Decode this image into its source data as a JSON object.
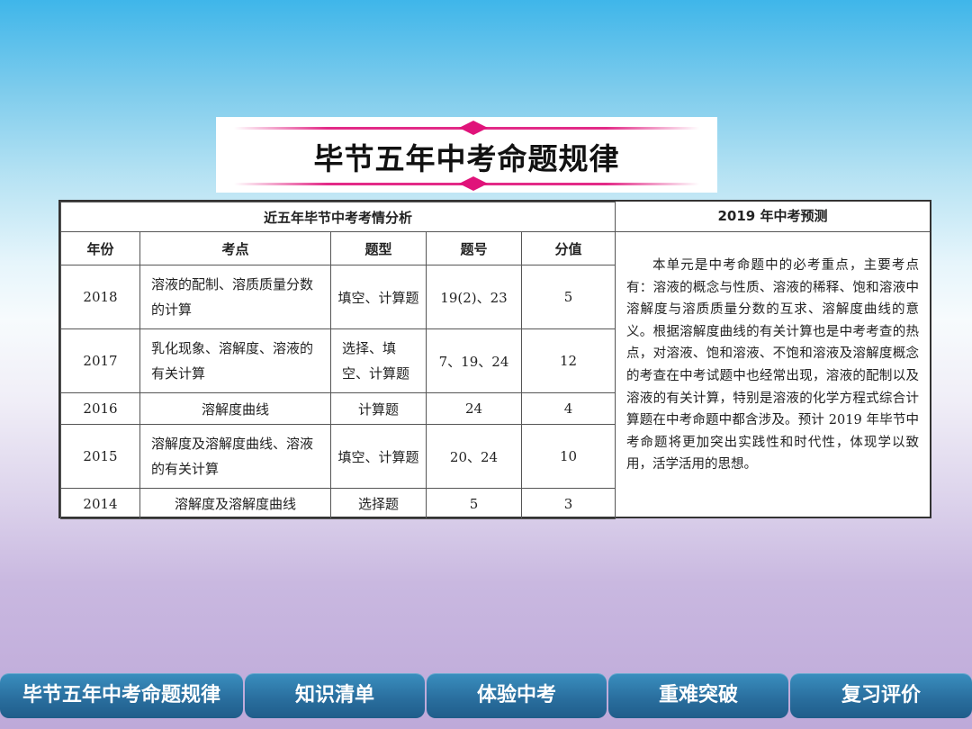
{
  "title": "毕节五年中考命题规律",
  "table": {
    "group_header": "近五年毕节中考考情分析",
    "columns": [
      "年份",
      "考点",
      "题型",
      "题号",
      "分值"
    ],
    "rows": [
      {
        "year": "2018",
        "topic": "溶液的配制、溶质质量分数的计算",
        "type": "填空、计算题",
        "number": "19(2)、23",
        "score": "5"
      },
      {
        "year": "2017",
        "topic": "乳化现象、溶解度、溶液的有关计算",
        "type": "选择、填空、计算题",
        "number": "7、19、24",
        "score": "12"
      },
      {
        "year": "2016",
        "topic": "溶解度曲线",
        "type": "计算题",
        "number": "24",
        "score": "4"
      },
      {
        "year": "2015",
        "topic": "溶解度及溶解度曲线、溶液的有关计算",
        "type": "填空、计算题",
        "number": "20、24",
        "score": "10"
      },
      {
        "year": "2014",
        "topic": "溶解度及溶解度曲线",
        "type": "选择题",
        "number": "5",
        "score": "3"
      }
    ]
  },
  "prediction": {
    "header": "2019 年中考预测",
    "body": "本单元是中考命题中的必考重点，主要考点有：溶液的概念与性质、溶液的稀释、饱和溶液中溶解度与溶质质量分数的互求、溶解度曲线的意义。根据溶解度曲线的有关计算也是中考考查的热点，对溶液、饱和溶液、不饱和溶液及溶解度概念的考查在中考试题中也经常出现，溶液的配制以及溶液的有关计算，特别是溶液的化学方程式综合计算题在中考命题中都含涉及。预计 2019 年毕节中考命题将更加突出实践性和时代性，体现学以致用，活学活用的思想。"
  },
  "nav": {
    "items": [
      "毕节五年中考命题规律",
      "知识清单",
      "体验中考",
      "重难突破",
      "复习评价"
    ]
  },
  "colors": {
    "accent_magenta": "#e0137a",
    "nav_blue": "#2a6f9f"
  }
}
